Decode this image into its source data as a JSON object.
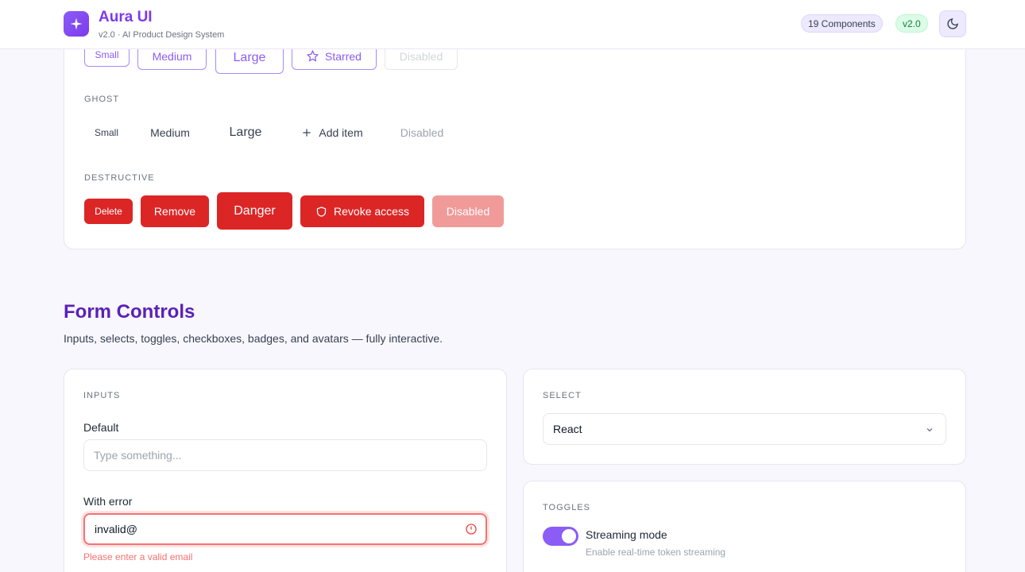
{
  "header": {
    "title": "Aura UI",
    "subtitle": "v2.0 · AI Product Design System",
    "components_badge": "19 Components",
    "version_badge": "v2.0",
    "logo_icon": "sparkle-icon",
    "theme_icon": "moon-icon"
  },
  "buttons": {
    "outline_row": [
      "Small",
      "Medium",
      "Large",
      "Starred",
      "Disabled"
    ],
    "ghost_label": "GHOST",
    "ghost_row": [
      "Small",
      "Medium",
      "Large",
      "Add item",
      "Disabled"
    ],
    "destructive_label": "DESTRUCTIVE",
    "destructive_row": [
      "Delete",
      "Remove",
      "Danger",
      "Revoke access",
      "Disabled"
    ]
  },
  "form_controls": {
    "title": "Form Controls",
    "description": "Inputs, selects, toggles, checkboxes, badges, and avatars — fully interactive.",
    "inputs": {
      "label": "INPUTS",
      "default_label": "Default",
      "default_placeholder": "Type something...",
      "error_label": "With error",
      "error_value": "invalid@",
      "error_message": "Please enter a valid email"
    },
    "select": {
      "label": "SELECT",
      "value": "React"
    },
    "toggles": {
      "label": "TOGGLES",
      "streaming_title": "Streaming mode",
      "streaming_desc": "Enable real-time token streaming",
      "streaming_on": true
    }
  },
  "colors": {
    "accent": "#7c3aed",
    "danger": "#dc2626",
    "success": "#15803d"
  }
}
